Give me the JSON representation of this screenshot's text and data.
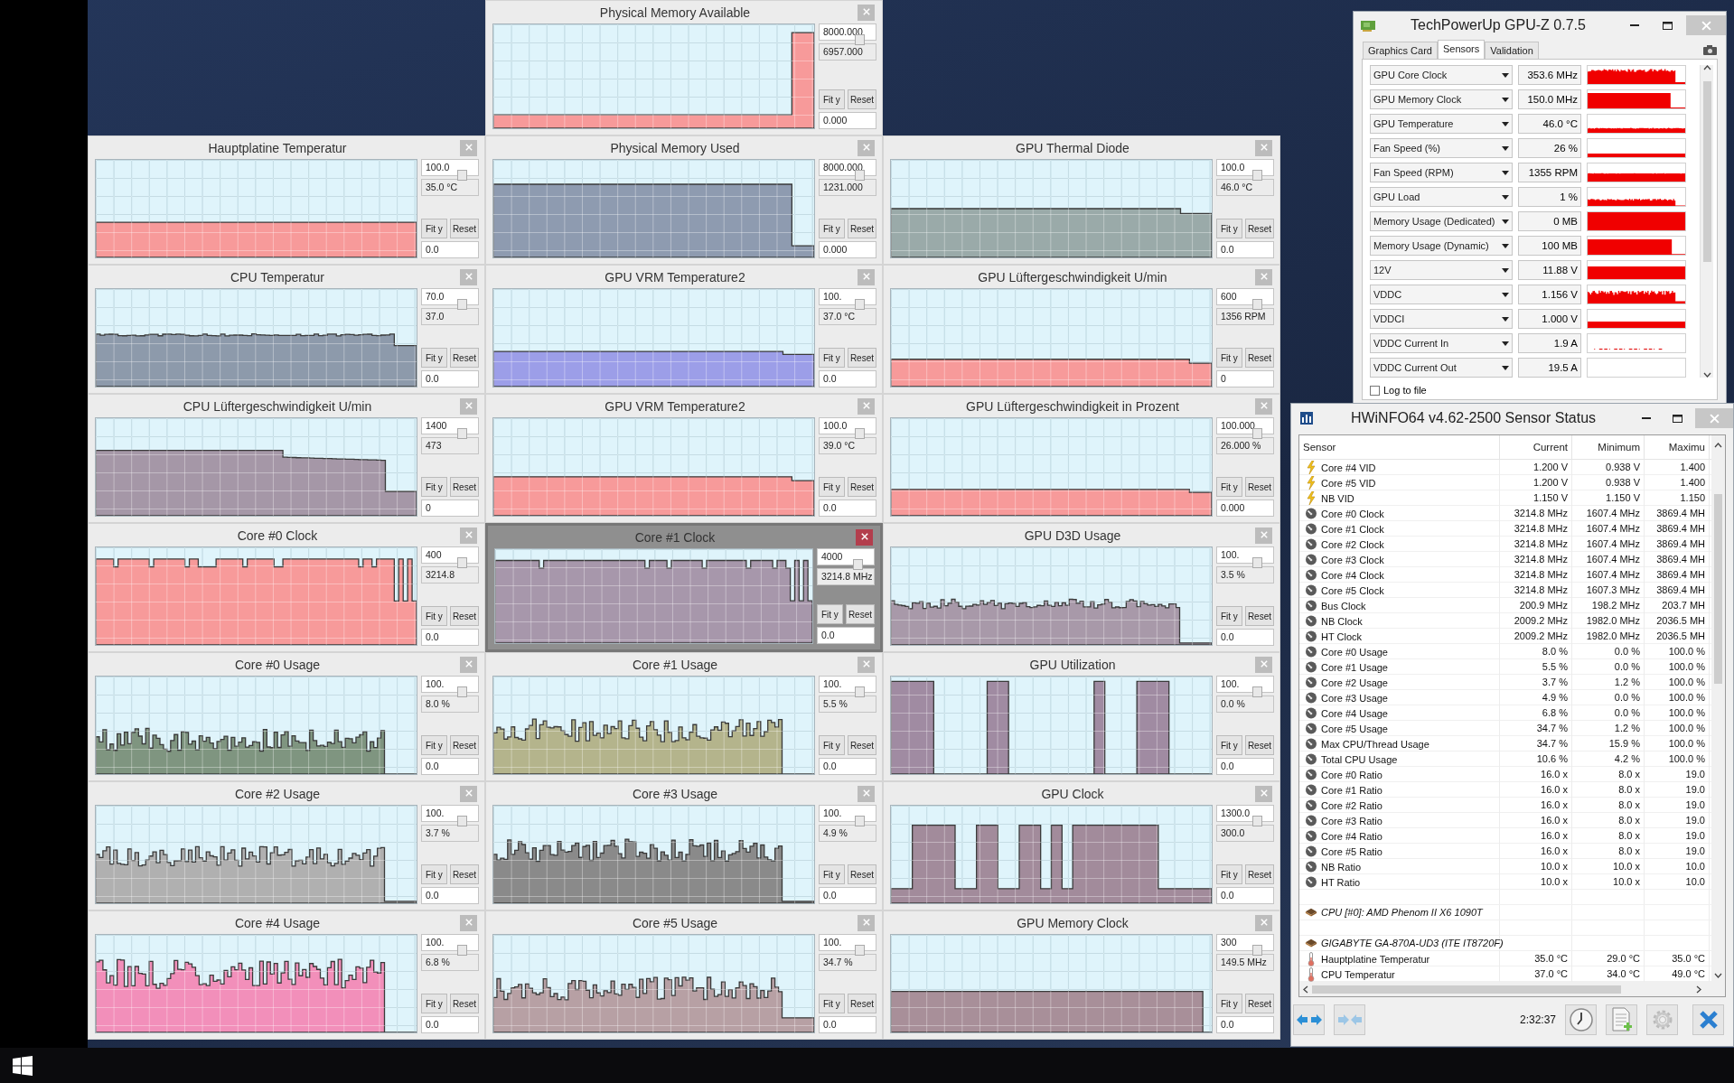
{
  "graph_windows": [
    {
      "title": "Physical Memory Available",
      "max": "8000.000",
      "current": "6957.000",
      "min": "0.000",
      "buttons": [
        "Fit y",
        "Reset"
      ],
      "color": "#f79a9a",
      "selected": false
    },
    {
      "title": "Hauptplatine Temperatur",
      "max": "100.0",
      "current": "35.0 °C",
      "min": "0.0",
      "buttons": [
        "Fit y",
        "Reset"
      ],
      "color": "#f79a9a",
      "selected": false
    },
    {
      "title": "Physical Memory Used",
      "max": "8000.000",
      "current": "1231.000",
      "min": "0.000",
      "buttons": [
        "Fit y",
        "Reset"
      ],
      "color": "#8e9bb0",
      "selected": false
    },
    {
      "title": "GPU Thermal Diode",
      "max": "100.0",
      "current": "46.0 °C",
      "min": "0.0",
      "buttons": [
        "Fit y",
        "Reset"
      ],
      "color": "#9aaaa9",
      "selected": false
    },
    {
      "title": "CPU Temperatur",
      "max": "70.0",
      "current": "37.0",
      "min": "0.0",
      "buttons": [
        "Fit y",
        "Reset"
      ],
      "color": "#8d9aab",
      "selected": false
    },
    {
      "title": "GPU VRM Temperature2",
      "max": "100.",
      "current": "37.0 °C",
      "min": "0.0",
      "buttons": [
        "Fit y",
        "Reset"
      ],
      "color": "#9c9ee8",
      "selected": false
    },
    {
      "title": "GPU Lüftergeschwindigkeit U/min",
      "max": "600",
      "current": "1356 RPM",
      "min": "0",
      "buttons": [
        "Fit y",
        "Reset"
      ],
      "color": "#f79a9a",
      "selected": false
    },
    {
      "title": "CPU Lüftergeschwindigkeit U/min",
      "max": "1400",
      "current": "473",
      "min": "0",
      "buttons": [
        "Fit y",
        "Reset"
      ],
      "color": "#a597a7",
      "selected": false
    },
    {
      "title": "GPU VRM Temperature2",
      "max": "100.0",
      "current": "39.0 °C",
      "min": "0.0",
      "buttons": [
        "Fit y",
        "Reset"
      ],
      "color": "#f79a9a",
      "selected": false
    },
    {
      "title": "GPU Lüftergeschwindigkeit in Prozent",
      "max": "100.000",
      "current": "26.000 %",
      "min": "0.000",
      "buttons": [
        "Fit y",
        "Reset"
      ],
      "color": "#f79a9a",
      "selected": false
    },
    {
      "title": "Core #0 Clock",
      "max": "400",
      "current": "3214.8",
      "min": "0.0",
      "buttons": [
        "Fit y",
        "Reset"
      ],
      "color": "#f79a9a",
      "selected": false
    },
    {
      "title": "Core #1 Clock",
      "max": "4000",
      "current": "3214.8 MHz",
      "min": "0.0",
      "buttons": [
        "Fit y",
        "Reset"
      ],
      "color": "#a797ab",
      "selected": true
    },
    {
      "title": "GPU D3D Usage",
      "max": "100.",
      "current": "3.5 %",
      "min": "0.0",
      "buttons": [
        "Fit y",
        "Reset"
      ],
      "color": "#a899a9",
      "selected": false
    },
    {
      "title": "Core #0 Usage",
      "max": "100.",
      "current": "8.0 %",
      "min": "0.0",
      "buttons": [
        "Fit y",
        "Reset"
      ],
      "color": "#7f9580",
      "selected": false
    },
    {
      "title": "Core #1 Usage",
      "max": "100.",
      "current": "5.5 %",
      "min": "0.0",
      "buttons": [
        "Fit y",
        "Reset"
      ],
      "color": "#b4b48c",
      "selected": false
    },
    {
      "title": "GPU Utilization",
      "max": "100.",
      "current": "0.0 %",
      "min": "0.0",
      "buttons": [
        "Fit y",
        "Reset"
      ],
      "color": "#a08ba2",
      "selected": false
    },
    {
      "title": "Core #2 Usage",
      "max": "100.",
      "current": "3.7 %",
      "min": "0.0",
      "buttons": [
        "Fit y",
        "Reset"
      ],
      "color": "#b0b0b0",
      "selected": false
    },
    {
      "title": "Core #3 Usage",
      "max": "100.",
      "current": "4.9 %",
      "min": "0.0",
      "buttons": [
        "Fit y",
        "Reset"
      ],
      "color": "#8a8a8a",
      "selected": false
    },
    {
      "title": "GPU Clock",
      "max": "1300.0",
      "current": "300.0",
      "min": "0.0",
      "buttons": [
        "Fit y",
        "Reset"
      ],
      "color": "#a28b9b",
      "selected": false
    },
    {
      "title": "Core #4 Usage",
      "max": "100.",
      "current": "6.8 %",
      "min": "0.0",
      "buttons": [
        "Fit y",
        "Reset"
      ],
      "color": "#f28fba",
      "selected": false
    },
    {
      "title": "Core #5 Usage",
      "max": "100.",
      "current": "34.7 %",
      "min": "0.0",
      "buttons": [
        "Fit y",
        "Reset"
      ],
      "color": "#b7a0a4",
      "selected": false
    },
    {
      "title": "GPU Memory Clock",
      "max": "300",
      "current": "149.5 MHz",
      "min": "0.0",
      "buttons": [
        "Fit y",
        "Reset"
      ],
      "color": "#a88f99",
      "selected": false
    }
  ],
  "gpuz": {
    "title": "TechPowerUp GPU-Z 0.7.5",
    "tabs": [
      {
        "label": "Graphics Card",
        "selected": false
      },
      {
        "label": "Sensors",
        "selected": true
      },
      {
        "label": "Validation",
        "selected": false
      }
    ],
    "sensors": [
      {
        "name": "GPU Core Clock",
        "value": "353.6 MHz"
      },
      {
        "name": "GPU Memory Clock",
        "value": "150.0 MHz"
      },
      {
        "name": "GPU Temperature",
        "value": "46.0 °C"
      },
      {
        "name": "Fan Speed (%)",
        "value": "26 %"
      },
      {
        "name": "Fan Speed (RPM)",
        "value": "1355 RPM"
      },
      {
        "name": "GPU Load",
        "value": "1 %"
      },
      {
        "name": "Memory Usage (Dedicated)",
        "value": "0 MB"
      },
      {
        "name": "Memory Usage (Dynamic)",
        "value": "100 MB"
      },
      {
        "name": "12V",
        "value": "11.88 V"
      },
      {
        "name": "VDDC",
        "value": "1.156 V"
      },
      {
        "name": "VDDCI",
        "value": "1.000 V"
      },
      {
        "name": "VDDC Current In",
        "value": "1.9 A"
      },
      {
        "name": "VDDC Current Out",
        "value": "19.5 A"
      }
    ],
    "log_to_file": {
      "label": "Log to file",
      "checked": false
    }
  },
  "hwinfo": {
    "title": "HWiNFO64 v4.62-2500 Sensor Status",
    "columns": [
      "Sensor",
      "Current",
      "Minimum",
      "Maximu"
    ],
    "rows": [
      {
        "kind": "voltage",
        "name": "Core #4 VID",
        "current": "1.200 V",
        "minimum": "0.938 V",
        "maximum": "1.400"
      },
      {
        "kind": "voltage",
        "name": "Core #5 VID",
        "current": "1.200 V",
        "minimum": "0.938 V",
        "maximum": "1.400"
      },
      {
        "kind": "voltage",
        "name": "NB VID",
        "current": "1.150 V",
        "minimum": "1.150 V",
        "maximum": "1.150"
      },
      {
        "kind": "gauge",
        "name": "Core #0 Clock",
        "current": "3214.8 MHz",
        "minimum": "1607.4 MHz",
        "maximum": "3869.4 MH"
      },
      {
        "kind": "gauge",
        "name": "Core #1 Clock",
        "current": "3214.8 MHz",
        "minimum": "1607.4 MHz",
        "maximum": "3869.4 MH"
      },
      {
        "kind": "gauge",
        "name": "Core #2 Clock",
        "current": "3214.8 MHz",
        "minimum": "1607.4 MHz",
        "maximum": "3869.4 MH"
      },
      {
        "kind": "gauge",
        "name": "Core #3 Clock",
        "current": "3214.8 MHz",
        "minimum": "1607.4 MHz",
        "maximum": "3869.4 MH"
      },
      {
        "kind": "gauge",
        "name": "Core #4 Clock",
        "current": "3214.8 MHz",
        "minimum": "1607.4 MHz",
        "maximum": "3869.4 MH"
      },
      {
        "kind": "gauge",
        "name": "Core #5 Clock",
        "current": "3214.8 MHz",
        "minimum": "1607.3 MHz",
        "maximum": "3869.4 MH"
      },
      {
        "kind": "gauge",
        "name": "Bus Clock",
        "current": "200.9 MHz",
        "minimum": "198.2 MHz",
        "maximum": "203.7 MH"
      },
      {
        "kind": "gauge",
        "name": "NB Clock",
        "current": "2009.2 MHz",
        "minimum": "1982.0 MHz",
        "maximum": "2036.5 MH"
      },
      {
        "kind": "gauge",
        "name": "HT Clock",
        "current": "2009.2 MHz",
        "minimum": "1982.0 MHz",
        "maximum": "2036.5 MH"
      },
      {
        "kind": "gauge",
        "name": "Core #0 Usage",
        "current": "8.0 %",
        "minimum": "0.0 %",
        "maximum": "100.0 %"
      },
      {
        "kind": "gauge",
        "name": "Core #1 Usage",
        "current": "5.5 %",
        "minimum": "0.0 %",
        "maximum": "100.0 %"
      },
      {
        "kind": "gauge",
        "name": "Core #2 Usage",
        "current": "3.7 %",
        "minimum": "1.2 %",
        "maximum": "100.0 %"
      },
      {
        "kind": "gauge",
        "name": "Core #3 Usage",
        "current": "4.9 %",
        "minimum": "0.0 %",
        "maximum": "100.0 %"
      },
      {
        "kind": "gauge",
        "name": "Core #4 Usage",
        "current": "6.8 %",
        "minimum": "0.0 %",
        "maximum": "100.0 %"
      },
      {
        "kind": "gauge",
        "name": "Core #5 Usage",
        "current": "34.7 %",
        "minimum": "1.2 %",
        "maximum": "100.0 %"
      },
      {
        "kind": "gauge",
        "name": "Max CPU/Thread Usage",
        "current": "34.7 %",
        "minimum": "15.9 %",
        "maximum": "100.0 %"
      },
      {
        "kind": "gauge",
        "name": "Total CPU Usage",
        "current": "10.6 %",
        "minimum": "4.2 %",
        "maximum": "100.0 %"
      },
      {
        "kind": "gauge",
        "name": "Core #0 Ratio",
        "current": "16.0 x",
        "minimum": "8.0 x",
        "maximum": "19.0"
      },
      {
        "kind": "gauge",
        "name": "Core #1 Ratio",
        "current": "16.0 x",
        "minimum": "8.0 x",
        "maximum": "19.0"
      },
      {
        "kind": "gauge",
        "name": "Core #2 Ratio",
        "current": "16.0 x",
        "minimum": "8.0 x",
        "maximum": "19.0"
      },
      {
        "kind": "gauge",
        "name": "Core #3 Ratio",
        "current": "16.0 x",
        "minimum": "8.0 x",
        "maximum": "19.0"
      },
      {
        "kind": "gauge",
        "name": "Core #4 Ratio",
        "current": "16.0 x",
        "minimum": "8.0 x",
        "maximum": "19.0"
      },
      {
        "kind": "gauge",
        "name": "Core #5 Ratio",
        "current": "16.0 x",
        "minimum": "8.0 x",
        "maximum": "19.0"
      },
      {
        "kind": "gauge",
        "name": "NB Ratio",
        "current": "10.0 x",
        "minimum": "10.0 x",
        "maximum": "10.0"
      },
      {
        "kind": "gauge",
        "name": "HT Ratio",
        "current": "10.0 x",
        "minimum": "10.0 x",
        "maximum": "10.0"
      },
      {
        "kind": "group",
        "name": "CPU [#0]: AMD Phenom II X6 1090T"
      },
      {
        "kind": "group",
        "name": "GIGABYTE GA-870A-UD3 (ITE IT8720F)"
      },
      {
        "kind": "temperature",
        "name": "Hauptplatine Temperatur",
        "current": "35.0 °C",
        "minimum": "29.0 °C",
        "maximum": "35.0 °C"
      },
      {
        "kind": "temperature",
        "name": "CPU Temperatur",
        "current": "37.0 °C",
        "minimum": "34.0 °C",
        "maximum": "49.0 °C"
      }
    ],
    "time": "2:32:37"
  }
}
